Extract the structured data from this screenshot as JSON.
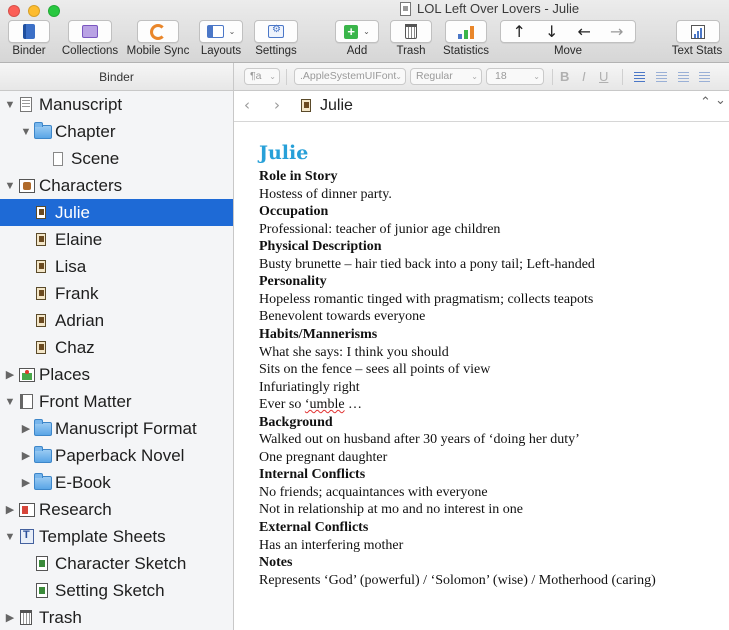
{
  "window": {
    "title": "LOL Left Over Lovers - Julie"
  },
  "toolbar": {
    "binder": "Binder",
    "collections": "Collections",
    "mobile_sync": "Mobile Sync",
    "layouts": "Layouts",
    "settings": "Settings",
    "add": "Add",
    "trash": "Trash",
    "statistics": "Statistics",
    "move": "Move",
    "text_stats": "Text Stats",
    "move_up_icon": "↑",
    "move_down_icon": "↓",
    "move_left_icon": "←",
    "move_right_icon": "→"
  },
  "formatbar": {
    "paragraph_style": "¶a",
    "font_family": ".AppleSystemUIFont",
    "font_style": "Regular",
    "font_size": "18",
    "bold": "B",
    "italic": "I",
    "underline": "U"
  },
  "binder": {
    "header": "Binder",
    "items": [
      {
        "label": "Manuscript",
        "expanded": true
      },
      {
        "label": "Chapter",
        "expanded": true
      },
      {
        "label": "Scene"
      },
      {
        "label": "Characters",
        "expanded": true
      },
      {
        "label": "Julie",
        "selected": true
      },
      {
        "label": "Elaine"
      },
      {
        "label": "Lisa"
      },
      {
        "label": "Frank"
      },
      {
        "label": "Adrian"
      },
      {
        "label": "Chaz"
      },
      {
        "label": "Places",
        "expanded": false
      },
      {
        "label": "Front Matter",
        "expanded": true
      },
      {
        "label": "Manuscript Format",
        "expanded": false
      },
      {
        "label": "Paperback Novel",
        "expanded": false
      },
      {
        "label": "E-Book",
        "expanded": false
      },
      {
        "label": "Research",
        "expanded": false
      },
      {
        "label": "Template Sheets",
        "expanded": true
      },
      {
        "label": "Character Sketch"
      },
      {
        "label": "Setting Sketch"
      },
      {
        "label": "Trash",
        "expanded": false
      }
    ]
  },
  "editor": {
    "nav_title": "Julie",
    "nav_back": "‹",
    "nav_forward": "›",
    "nav_up": "^",
    "nav_down": "v",
    "heading": "Julie",
    "lines": [
      {
        "text": "Role in Story",
        "bold": true
      },
      {
        "text": "Hostess of dinner party.",
        "bold": false
      },
      {
        "text": "Occupation",
        "bold": true
      },
      {
        "text": "Professional: teacher of junior age children",
        "bold": false
      },
      {
        "text": "Physical Description",
        "bold": true
      },
      {
        "text": "Busty brunette – hair tied back into a pony tail; Left-handed",
        "bold": false
      },
      {
        "text": "Personality",
        "bold": true
      },
      {
        "text": "Hopeless romantic tinged with pragmatism; collects teapots",
        "bold": false
      },
      {
        "text": "Benevolent towards everyone",
        "bold": false
      },
      {
        "text": "Habits/Mannerisms",
        "bold": true
      },
      {
        "text": "What she says: I think you should",
        "bold": false
      },
      {
        "text": "Sits on the fence – sees all points of view",
        "bold": false
      },
      {
        "text": "Infuriatingly right",
        "bold": false
      },
      {
        "text": "Ever so ‘umble …",
        "bold": false
      },
      {
        "text": "Background",
        "bold": true
      },
      {
        "text": "Walked out on husband after 30 years of ‘doing her duty’",
        "bold": false
      },
      {
        "text": "One pregnant daughter",
        "bold": false
      },
      {
        "text": "Internal Conflicts",
        "bold": true
      },
      {
        "text": "No friends; acquaintances with everyone",
        "bold": false
      },
      {
        "text": "Not in relationship at mo and no interest in one",
        "bold": false
      },
      {
        "text": "External Conflicts",
        "bold": true
      },
      {
        "text": "Has an interfering mother",
        "bold": false
      },
      {
        "text": "Notes",
        "bold": true
      },
      {
        "text": "Represents ‘God’ (powerful) / ‘Solomon’  (wise) / Motherhood (caring)",
        "bold": false
      }
    ]
  },
  "colors": {
    "selection": "#1e6ad6",
    "heading": "#27a0d8",
    "add_green": "#3ab54a",
    "sync_orange": "#e9862a"
  },
  "icons": {
    "binder": "binder-icon",
    "collections": "collections-icon",
    "mobile_sync": "sync-icon",
    "layouts": "layout-icon",
    "settings": "settings-icon",
    "add": "add-icon",
    "trash": "trash-icon",
    "statistics": "bar-chart-icon",
    "text_stats": "text-stats-icon"
  }
}
